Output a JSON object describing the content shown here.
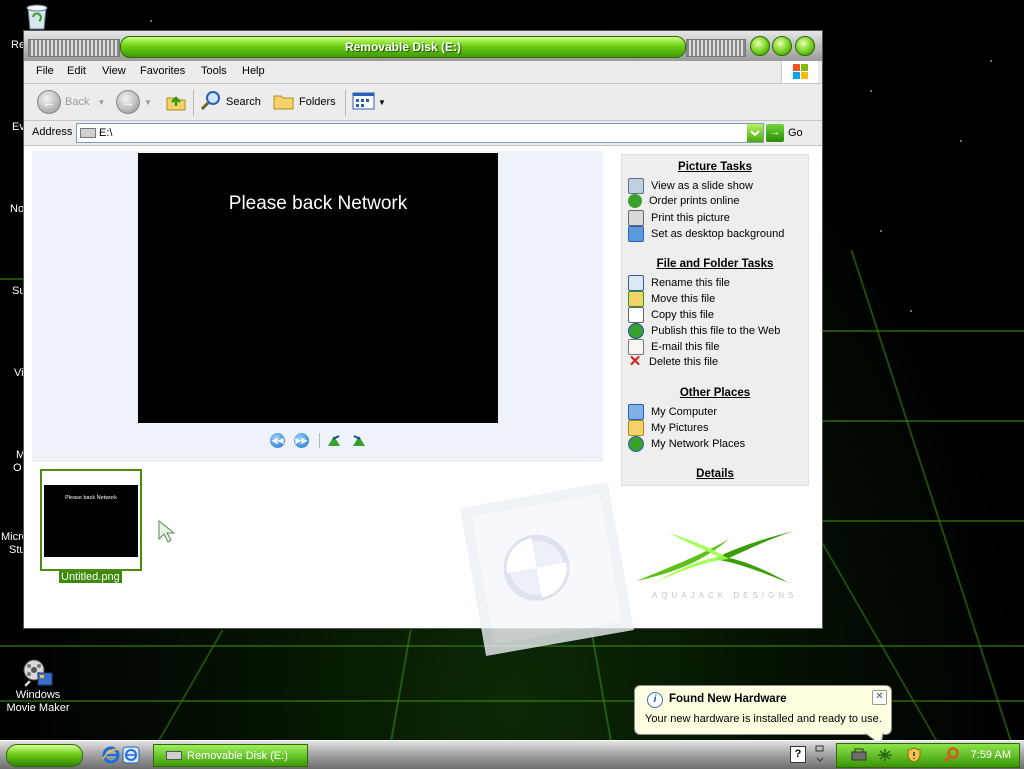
{
  "window": {
    "title": "Removable Disk (E:)"
  },
  "menu": [
    "File",
    "Edit",
    "View",
    "Favorites",
    "Tools",
    "Help"
  ],
  "toolbar": {
    "back_label": "Back",
    "search_label": "Search",
    "folders_label": "Folders"
  },
  "address": {
    "label": "Address",
    "value": "E:\\",
    "go_label": "Go"
  },
  "preview": {
    "image_text": "Please back Network"
  },
  "thumbnail": {
    "filename": "Untitled.png",
    "image_text": "Please back Network"
  },
  "tasks": {
    "picture_tasks": {
      "heading": "Picture Tasks",
      "items": [
        "View as a slide show",
        "Order prints online",
        "Print this picture",
        "Set as desktop background"
      ]
    },
    "file_folder_tasks": {
      "heading": "File and Folder Tasks",
      "items": [
        "Rename this file",
        "Move this file",
        "Copy this file",
        "Publish this file to the Web",
        "E-mail this file",
        "Delete this file"
      ]
    },
    "other_places": {
      "heading": "Other Places",
      "items": [
        "My Computer",
        "My Pictures",
        "My Network Places"
      ]
    },
    "details": {
      "heading": "Details"
    }
  },
  "branding": {
    "logo_text": "AQUAJACK DESIGNS"
  },
  "desktop": {
    "icons": [
      {
        "label": "Windows Movie Maker"
      }
    ],
    "partial_labels": [
      "Re",
      "Ev",
      "No",
      "Su",
      "Vi",
      "M",
      "O",
      "Micro",
      "Stu"
    ]
  },
  "notification": {
    "title": "Found New Hardware",
    "message": "Your new hardware is installed and ready to use."
  },
  "taskbar": {
    "task_button_label": "Removable Disk (E:)",
    "clock": "7:59 AM"
  },
  "colors": {
    "accent": "#5cc114",
    "title_text": "#ffffff",
    "task_bg": "#eeeeee"
  }
}
